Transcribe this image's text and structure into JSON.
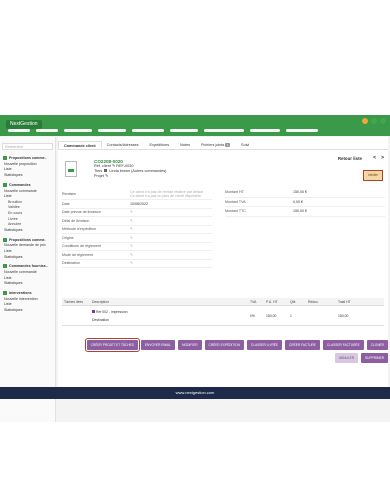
{
  "app": {
    "logo": "NextGestion",
    "window_dots": [
      "#f0a63a",
      "#3fa94a",
      "#3fa94a"
    ],
    "nav_count": 9,
    "accent": "#3a9a4a",
    "footer_text": "www.nextgestion.com"
  },
  "sidebar": {
    "search_placeholder": "Rechercher",
    "sections": [
      {
        "title": "Propositions comme..",
        "icon": "proposal-icon",
        "items": [
          "Nouvelle proposition",
          "Liste",
          "Statistiques"
        ],
        "subs": []
      },
      {
        "title": "Commandes",
        "icon": "order-icon",
        "items": [
          "Nouvelle commande",
          "Liste"
        ],
        "subs": [
          "Brouillon",
          "Validée",
          "En cours",
          "Livrée",
          "Annulée"
        ],
        "after": [
          "Statistiques"
        ]
      },
      {
        "title": "Propositions comme.",
        "icon": "supplier-proposal-icon",
        "items": [
          "Nouvelle demande de prix",
          "Liste",
          "Statistiques"
        ],
        "subs": []
      },
      {
        "title": "Commandes fourniss..",
        "icon": "supplier-order-icon",
        "items": [
          "Nouvelle commande",
          "Liste",
          "Statistiques"
        ],
        "subs": []
      },
      {
        "title": "Interventions",
        "icon": "intervention-icon",
        "items": [
          "Nouvelle intervention",
          "Liste",
          "Statistiques"
        ],
        "subs": []
      }
    ]
  },
  "tabs": [
    {
      "label": "Commande client",
      "active": true
    },
    {
      "label": "Contacts/Adresses",
      "active": false
    },
    {
      "label": "Expéditions",
      "active": false
    },
    {
      "label": "Notes",
      "active": false
    },
    {
      "label": "Fichiers joints",
      "active": false,
      "badge": "1"
    },
    {
      "label": "Suivi",
      "active": false
    }
  ],
  "header": {
    "ref": "CO2208-0020",
    "ref_client_label": "Réf. client",
    "ref_client_value": "REF-0030",
    "third_party_label": "Tiers",
    "third_party_value": "Linda brown (Autres commandes)",
    "project_label": "Projet",
    "back_link": "Retour liste",
    "prev": "<",
    "next": ">",
    "status": "Validée"
  },
  "properties_left": [
    {
      "label": "Remises",
      "value": "Ce client n'a pas de remise relative par défaut",
      "value2": "Ce client n'a pas ou plus de crédit disponible",
      "muted": true,
      "pen": false
    },
    {
      "label": "Date",
      "value": "10/08/2022",
      "pen": false
    },
    {
      "label": "Date prévue de livraison",
      "value": "",
      "pen": true
    },
    {
      "label": "Délai de livraison",
      "value": "",
      "pen": true
    },
    {
      "label": "Méthode d'expédition",
      "value": "",
      "pen": true
    },
    {
      "label": "Origine",
      "value": "",
      "pen": true
    },
    {
      "label": "Conditions de règlement",
      "value": "",
      "pen": true
    },
    {
      "label": "Mode de règlement",
      "value": "",
      "pen": true
    },
    {
      "label": "Destination",
      "value": "",
      "pen": true
    }
  ],
  "properties_right": [
    {
      "label": "Montant HT",
      "value": "150,00 €"
    },
    {
      "label": "Montant TVA",
      "value": "0,00 €"
    },
    {
      "label": "Montant TTC",
      "value": "150,00 €"
    }
  ],
  "lines": {
    "headers": [
      "Tâches liées",
      "Description",
      "TVA",
      "P.U. HT",
      "Qté",
      "Réduc.",
      "Total HT"
    ],
    "rows": [
      {
        "task": "",
        "product": "Ref 002 - Impression",
        "description": "Destination",
        "tva": "0%",
        "pu_ht": "150,00",
        "qty": "1",
        "reduc": "",
        "total_ht": "150,00"
      }
    ]
  },
  "actions": [
    {
      "label": "CRÉER PROJET ET TÂCHES",
      "name": "create-project-button",
      "highlight": true
    },
    {
      "label": "ENVOYER EMAIL",
      "name": "send-email-button",
      "highlight": false
    },
    {
      "label": "MODIFIER",
      "name": "modify-button",
      "highlight": false
    },
    {
      "label": "CRÉER EXPÉDITION",
      "name": "create-shipment-button",
      "highlight": false
    },
    {
      "label": "CLASSER LIVRÉE",
      "name": "classify-delivered-button",
      "highlight": false
    },
    {
      "label": "CRÉER FACTURE",
      "name": "create-invoice-button",
      "highlight": false
    },
    {
      "label": "CLASSER FACTURÉE",
      "name": "classify-billed-button",
      "highlight": false
    },
    {
      "label": "CLONER",
      "name": "clone-button",
      "highlight": false
    },
    {
      "label": "ANNULER",
      "name": "cancel-button",
      "highlight": false,
      "light": true
    },
    {
      "label": "SUPPRIMER",
      "name": "delete-button",
      "highlight": false
    }
  ]
}
